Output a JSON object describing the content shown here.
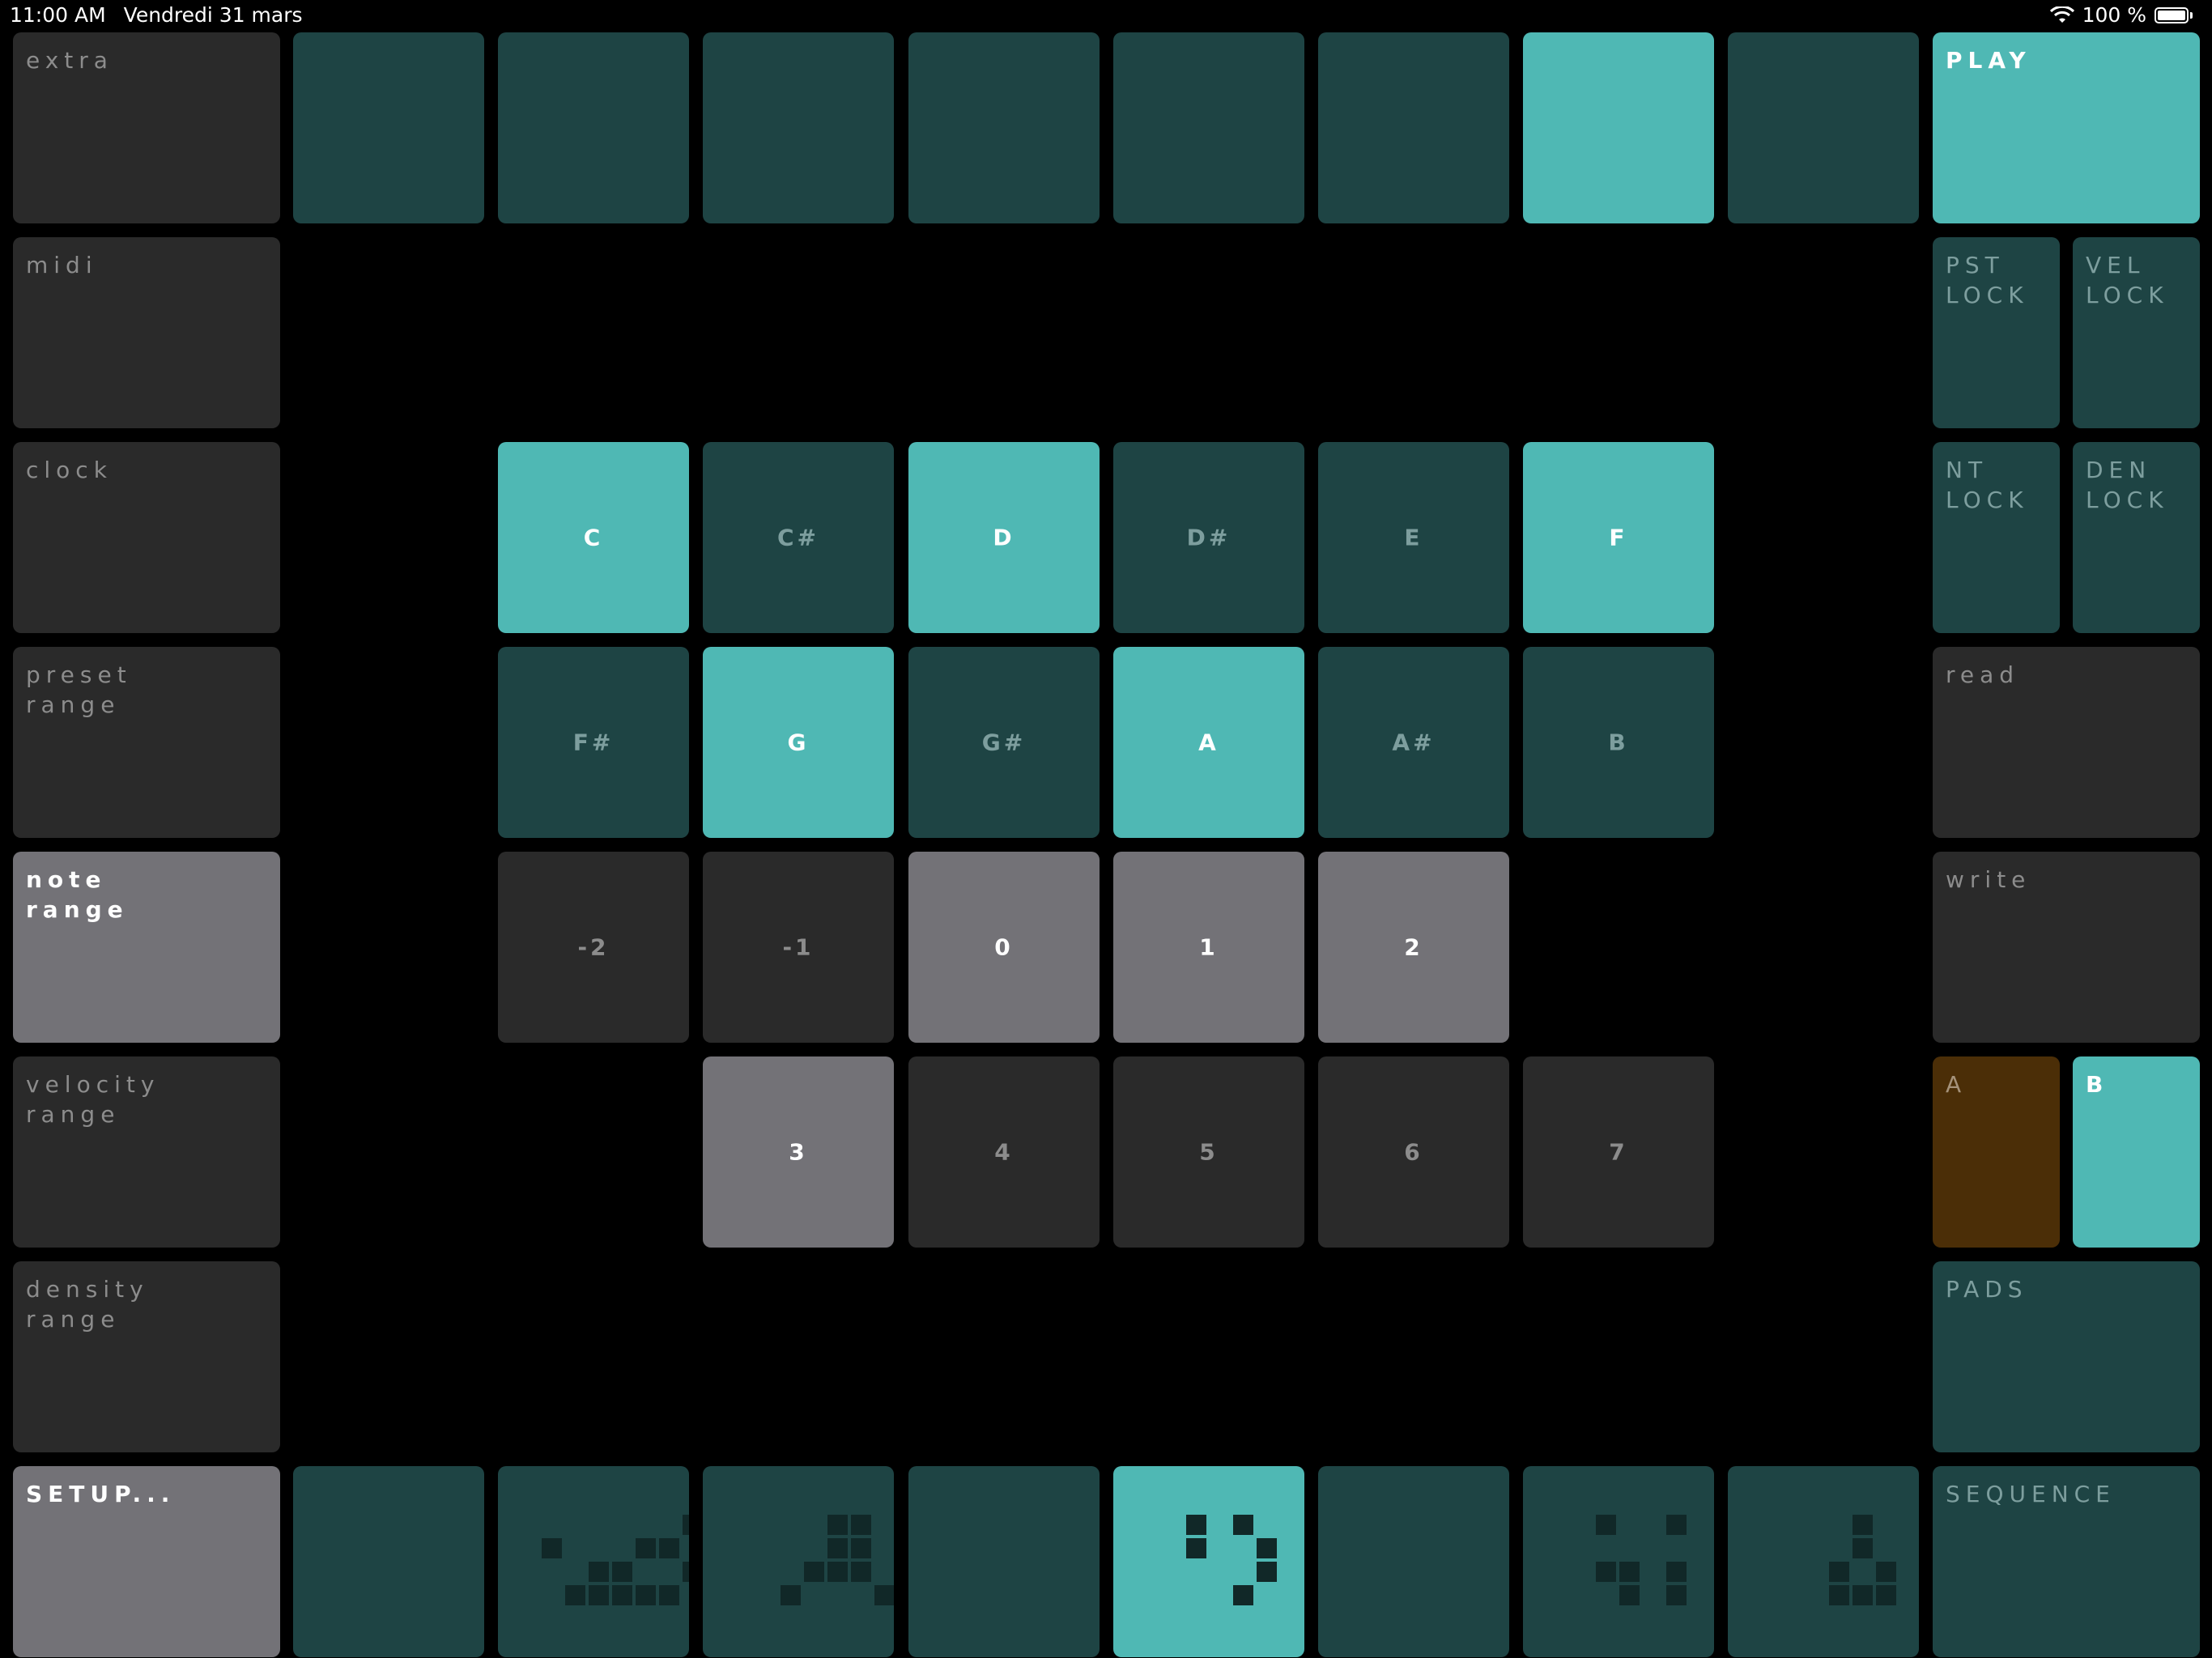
{
  "status": {
    "time": "11:00 AM",
    "date": "Vendredi 31 mars",
    "battery": "100 %",
    "wifi_icon": "wifi-icon",
    "battery_icon": "battery-icon"
  },
  "left_column": [
    {
      "key": "extra",
      "label": "extra",
      "active": false
    },
    {
      "key": "midi",
      "label": "midi",
      "active": false
    },
    {
      "key": "clock",
      "label": "clock",
      "active": false
    },
    {
      "key": "preset-range",
      "label": "preset\nrange",
      "active": false
    },
    {
      "key": "note-range",
      "label": "note\nrange",
      "active": true
    },
    {
      "key": "velocity-range",
      "label": "velocity\nrange",
      "active": false
    },
    {
      "key": "density-range",
      "label": "density\nrange",
      "active": false
    },
    {
      "key": "setup",
      "label": "SETUP...",
      "active": true
    }
  ],
  "top_row": {
    "active_index": 6,
    "count": 8
  },
  "right_column": {
    "play": "PLAY",
    "pst_lock": "PST\nLOCK",
    "vel_lock": "VEL\nLOCK",
    "nt_lock": "NT\nLOCK",
    "den_lock": "DEN\nLOCK",
    "read": "read",
    "write": "write",
    "a": "A",
    "b": "B",
    "pads": "PADS",
    "sequence": "SEQUENCE"
  },
  "notes_row1": [
    {
      "label": "C",
      "active": true
    },
    {
      "label": "C#",
      "active": false
    },
    {
      "label": "D",
      "active": true
    },
    {
      "label": "D#",
      "active": false
    },
    {
      "label": "E",
      "active": false
    },
    {
      "label": "F",
      "active": true
    }
  ],
  "notes_row2": [
    {
      "label": "F#",
      "active": false
    },
    {
      "label": "G",
      "active": true
    },
    {
      "label": "G#",
      "active": false
    },
    {
      "label": "A",
      "active": true
    },
    {
      "label": "A#",
      "active": false
    },
    {
      "label": "B",
      "active": false
    }
  ],
  "octaves_row1": [
    {
      "label": "-2",
      "active": false
    },
    {
      "label": "-1",
      "active": false
    },
    {
      "label": "0",
      "active": true
    },
    {
      "label": "1",
      "active": true
    },
    {
      "label": "2",
      "active": true
    }
  ],
  "octaves_row2": [
    {
      "label": "3",
      "active": true
    },
    {
      "label": "4",
      "active": false
    },
    {
      "label": "5",
      "active": false
    },
    {
      "label": "6",
      "active": false
    },
    {
      "label": "7",
      "active": false
    }
  ],
  "bottom_row": {
    "active_index": 4,
    "count": 8
  }
}
